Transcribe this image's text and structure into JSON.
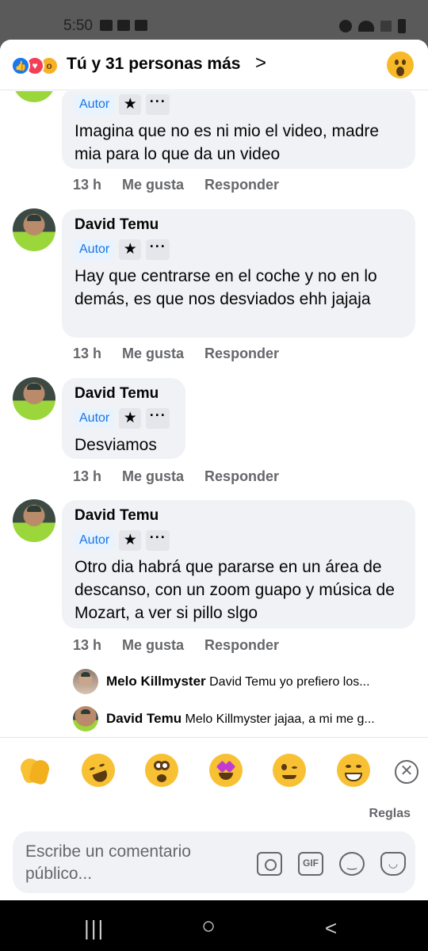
{
  "status_bar": {
    "time": "5:50"
  },
  "header": {
    "title": "Tú y 31 personas más",
    "reactions": [
      "like-icon",
      "love-icon",
      "wow-icon"
    ],
    "chevron": ">"
  },
  "comments": [
    {
      "author": "",
      "badge": "Autor",
      "text": "Imagina que no es ni mio el video, madre mia para lo que da un video",
      "time": "13 h",
      "like": "Me gusta",
      "reply": "Responder"
    },
    {
      "author": "David Temu",
      "badge": "Autor",
      "text": "Hay que centrarse en el coche y no en lo demás, es que nos desviados ehh jajaja",
      "time": "13 h",
      "like": "Me gusta",
      "reply": "Responder"
    },
    {
      "author": "David Temu",
      "badge": "Autor",
      "text": "Desviamos",
      "time": "13 h",
      "like": "Me gusta",
      "reply": "Responder"
    },
    {
      "author": "David Temu",
      "badge": "Autor",
      "text": "Otro dia habrá que pararse en un área de descanso, con un zoom guapo y música de Mozart, a ver si pillo slgo",
      "time": "13 h",
      "like": "Me gusta",
      "reply": "Responder"
    }
  ],
  "replies": [
    {
      "author": "Melo Killmyster",
      "text": "David Temu yo prefiero los..."
    },
    {
      "author": "David Temu",
      "text": "Melo Killmyster jajaa, a mi me g..."
    }
  ],
  "emoji_bar": {
    "emojis": [
      "clapping-hands-icon",
      "rolling-laughing-icon",
      "astonished-face-icon",
      "star-struck-icon",
      "winking-face-icon",
      "grinning-face-icon"
    ],
    "close": "✕",
    "rules": "Reglas"
  },
  "composer": {
    "placeholder": "Escribe un comentario público...",
    "gif_label": "GIF"
  },
  "nav": {
    "recents": "|||",
    "home": "○",
    "back": "<"
  }
}
